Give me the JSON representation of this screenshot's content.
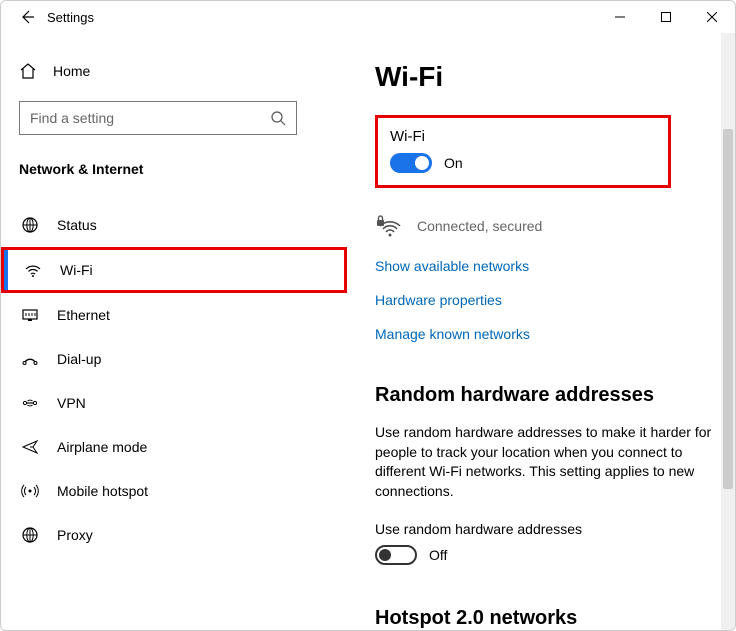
{
  "titlebar": {
    "title": "Settings"
  },
  "sidebar": {
    "home": "Home",
    "search_placeholder": "Find a setting",
    "section": "Network & Internet",
    "items": [
      {
        "label": "Status"
      },
      {
        "label": "Wi-Fi"
      },
      {
        "label": "Ethernet"
      },
      {
        "label": "Dial-up"
      },
      {
        "label": "VPN"
      },
      {
        "label": "Airplane mode"
      },
      {
        "label": "Mobile hotspot"
      },
      {
        "label": "Proxy"
      }
    ]
  },
  "main": {
    "heading": "Wi-Fi",
    "wifi": {
      "label": "Wi-Fi",
      "state": "On"
    },
    "connection_status": "Connected, secured",
    "links": {
      "show_networks": "Show available networks",
      "hardware": "Hardware properties",
      "known": "Manage known networks"
    },
    "random_hw": {
      "heading": "Random hardware addresses",
      "desc": "Use random hardware addresses to make it harder for people to track your location when you connect to different Wi-Fi networks. This setting applies to new connections.",
      "toggle_label": "Use random hardware addresses",
      "state": "Off"
    },
    "hotspot2": {
      "heading": "Hotspot 2.0 networks"
    }
  }
}
